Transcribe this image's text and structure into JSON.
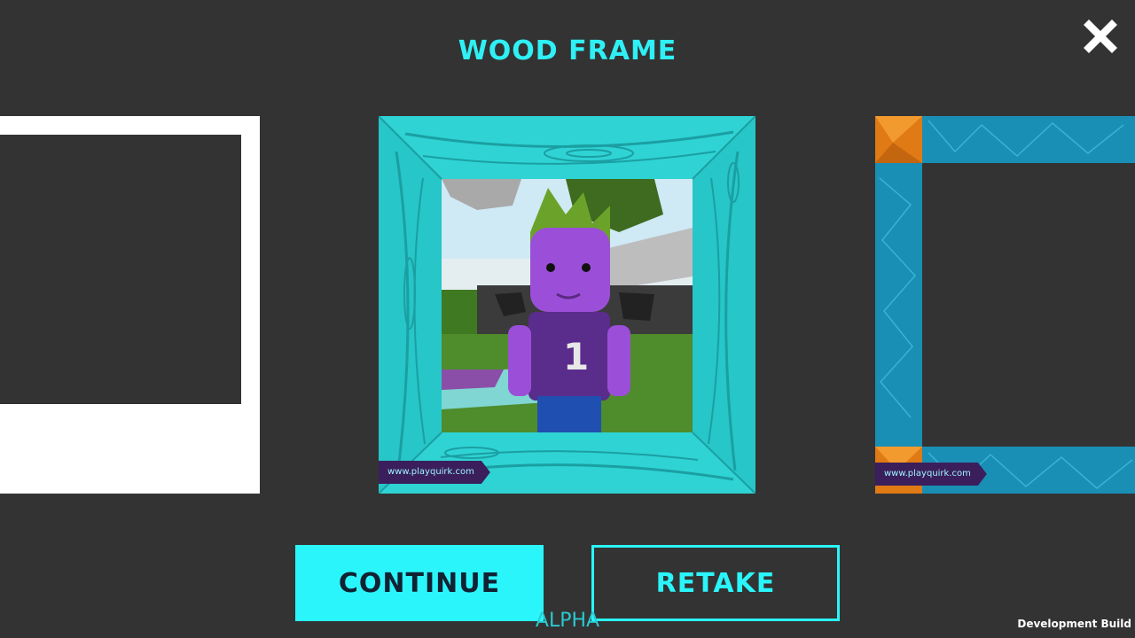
{
  "header": {
    "title": "WOOD FRAME"
  },
  "close": {
    "icon": "close-icon"
  },
  "frames": {
    "left": {
      "style": "polaroid-white"
    },
    "center": {
      "style": "wood-cyan",
      "watermark": "www.playquirk.com",
      "avatar_jersey_number": "1"
    },
    "right": {
      "style": "crystal-blue-orange",
      "watermark": "www.playquirk.com"
    }
  },
  "actions": {
    "continue_label": "CONTINUE",
    "retake_label": "RETAKE"
  },
  "footer": {
    "alpha_label": "ALPHA",
    "dev_build_label": "Development Build"
  },
  "colors": {
    "accent": "#2AF5FA",
    "background": "#333333",
    "tag": "#3A1F5C"
  }
}
